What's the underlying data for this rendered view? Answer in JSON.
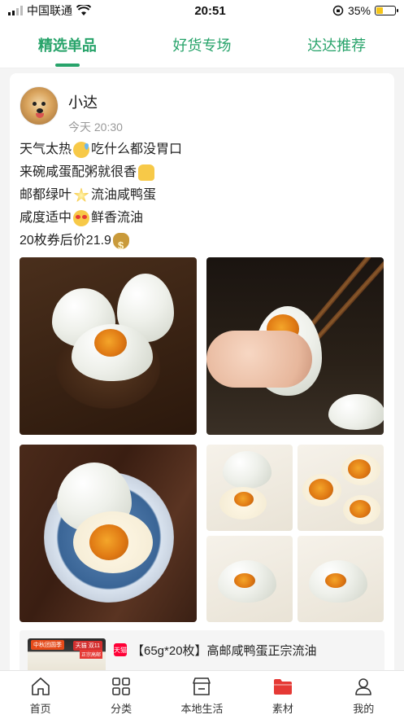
{
  "status_bar": {
    "carrier": "中国联通",
    "time": "20:51",
    "battery": "35%",
    "battery_level": 0.35
  },
  "tabs": [
    {
      "label": "精选单品",
      "active": true
    },
    {
      "label": "好货专场",
      "active": false
    },
    {
      "label": "达达推荐",
      "active": false
    }
  ],
  "post": {
    "author": "小达",
    "time": "今天 20:30",
    "lines": [
      {
        "text": "天气太热",
        "emoji": "sweat-emoji",
        "after": "吃什么都没胃口"
      },
      {
        "text": "来碗咸蛋配粥就很香",
        "emoji": "thumbs-up-emoji",
        "after": ""
      },
      {
        "text": "邮都绿叶",
        "emoji": "star-emoji",
        "after": "流油咸鸭蛋"
      },
      {
        "text": "咸度适中",
        "emoji": "heart-eyes-emoji",
        "after": "鲜香流油"
      },
      {
        "text": "20枚券后价21.9",
        "emoji": "money-bag-emoji",
        "after": ""
      }
    ]
  },
  "product": {
    "thumb_tags": [
      "天猫 双11",
      "中秋团圆季",
      "正宗高邮"
    ],
    "badge": "天猫",
    "title": "【65g*20枚】高邮咸鸭蛋正宗流油"
  },
  "navbar": [
    {
      "label": "首页",
      "icon": "home-icon"
    },
    {
      "label": "分类",
      "icon": "grid-icon"
    },
    {
      "label": "本地生活",
      "icon": "store-icon"
    },
    {
      "label": "素材",
      "icon": "folder-icon",
      "active": true
    },
    {
      "label": "我的",
      "icon": "person-icon"
    }
  ],
  "colors": {
    "accent": "#27a36a",
    "active_nav": "#e53935"
  }
}
